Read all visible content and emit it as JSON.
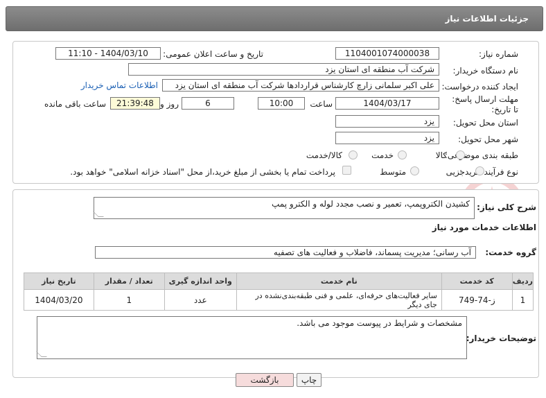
{
  "header": {
    "title": "جزئیات اطلاعات نیاز"
  },
  "form": {
    "need_number": {
      "label": "شماره نیاز:",
      "value": "1104001074000038"
    },
    "announce_datetime": {
      "label": "تاریخ و ساعت اعلان عمومی:",
      "value": "1404/03/10 - 11:10"
    },
    "buyer_org": {
      "label": "نام دستگاه خریدار:",
      "value": "شرکت آب منطقه ای استان یزد"
    },
    "requester": {
      "label": "ایجاد کننده درخواست:",
      "value": "علی اکبر سلمانی زارچ کارشناس قراردادها شرکت آب منطقه ای استان یزد",
      "contact_link": "اطلاعات تماس خریدار"
    },
    "deadline": {
      "label": "مهلت ارسال پاسخ: تا تاریخ:",
      "date": "1404/03/17",
      "time_label": "ساعت",
      "time": "10:00",
      "days": "6",
      "days_label": "روز و",
      "remaining": "21:39:48",
      "remaining_label": "ساعت باقی مانده"
    },
    "delivery_province": {
      "label": "استان محل تحویل:",
      "value": "یزد"
    },
    "delivery_city": {
      "label": "شهر محل تحویل:",
      "value": "یزد"
    },
    "category": {
      "label": "طبقه بندی موضوعی:",
      "options": [
        "کالا",
        "خدمت",
        "کالا/خدمت"
      ]
    },
    "purchase_type": {
      "label": "نوع فرآیند خرید :",
      "options": [
        "جزیی",
        "متوسط"
      ],
      "payment_note": "پرداخت تمام یا بخشی از مبلغ خرید،از محل \"اسناد خزانه اسلامی\" خواهد بود."
    }
  },
  "description": {
    "label": "شرح کلی نیاز:",
    "value": "کشیدن الکتروپمپ، تعمیر و نصب مجدد لوله و الکترو پمپ"
  },
  "services": {
    "section_title": "اطلاعات خدمات مورد نیاز",
    "group_label": "گروه خدمت:",
    "group_value": "آب رسانی؛ مدیریت پسماند، فاضلاب و فعالیت های تصفیه",
    "columns": [
      "ردیف",
      "کد خدمت",
      "نام خدمت",
      "واحد اندازه گیری",
      "تعداد / مقدار",
      "تاریخ نیاز"
    ],
    "rows": [
      {
        "index": "1",
        "code": "ز-74-749",
        "name": "سایر فعالیت‌های حرفه‌ای، علمی و فنی طبقه‌بندی‌نشده در جای دیگر",
        "unit": "عدد",
        "qty": "1",
        "date": "1404/03/20"
      }
    ]
  },
  "buyer_notes": {
    "label": "توضیحات خریدار:",
    "value": "مشخصات و شرایط در پیوست موجود می باشد."
  },
  "buttons": {
    "print": "چاپ",
    "back": "بازگشت"
  },
  "watermark": {
    "text": "AriaTender.neT"
  },
  "colors": {
    "header_bg": "#7d7d7d",
    "link": "#1a5fb4",
    "back_btn": "#f6dcdc",
    "watermark": "#d33b3b"
  }
}
